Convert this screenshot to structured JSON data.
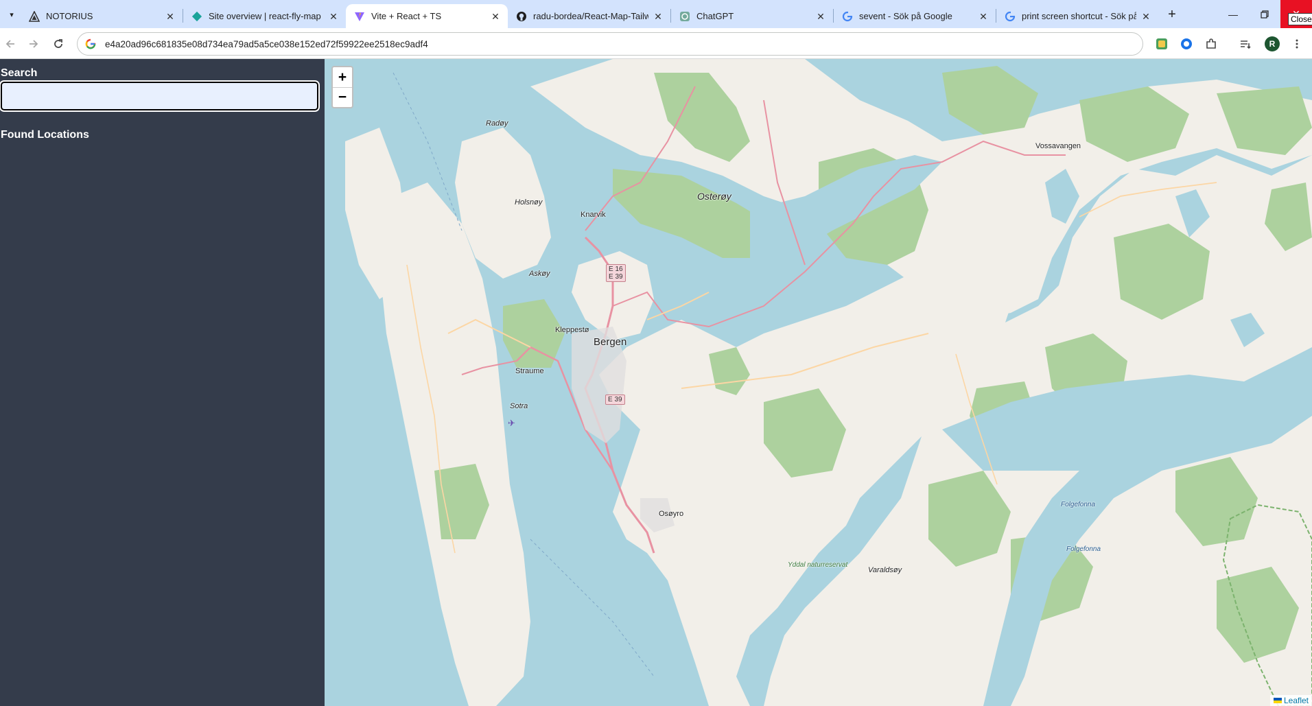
{
  "browser": {
    "tabs": [
      {
        "title": "NOTORIUS",
        "icon": "notorius-logo-icon"
      },
      {
        "title": "Site overview | react-fly-map |",
        "icon": "netlify-icon"
      },
      {
        "title": "Vite + React + TS",
        "icon": "vite-icon"
      },
      {
        "title": "radu-bordea/React-Map-Tailw",
        "icon": "github-icon"
      },
      {
        "title": "ChatGPT",
        "icon": "chatgpt-icon"
      },
      {
        "title": "sevent - Sök på Google",
        "icon": "google-icon"
      },
      {
        "title": "print screen shortcut - Sök på",
        "icon": "google-icon"
      }
    ],
    "active_tab": 2,
    "close_tooltip": "Close",
    "url": "e4a20ad96c681835e08d734ea79ad5a5ce038e152ed72f59922ee2518ec9adf4",
    "profile_initial": "R"
  },
  "sidebar": {
    "search_label": "Search",
    "search_value": "",
    "found_label": "Found Locations"
  },
  "map": {
    "zoom_in": "+",
    "zoom_out": "−",
    "attribution": "Leaflet",
    "places": {
      "radoy": "Radøy",
      "holsnoy": "Holsnøy",
      "knarvik": "Knarvik",
      "osteroy": "Osterøy",
      "askoy": "Askøy",
      "kleppesto": "Kleppestø",
      "bergen": "Bergen",
      "straume": "Straume",
      "sotra": "Sotra",
      "osoyro": "Osøyro",
      "vossavangen": "Vossavangen",
      "folgefonna1": "Folgefonna",
      "folgefonna2": "Folgefonna",
      "yddal": "Yddal naturreservat",
      "varaldsoy": "Varaldsøy"
    },
    "shields": {
      "e16_e39": "E 16\nE 39",
      "e39": "E 39"
    }
  }
}
